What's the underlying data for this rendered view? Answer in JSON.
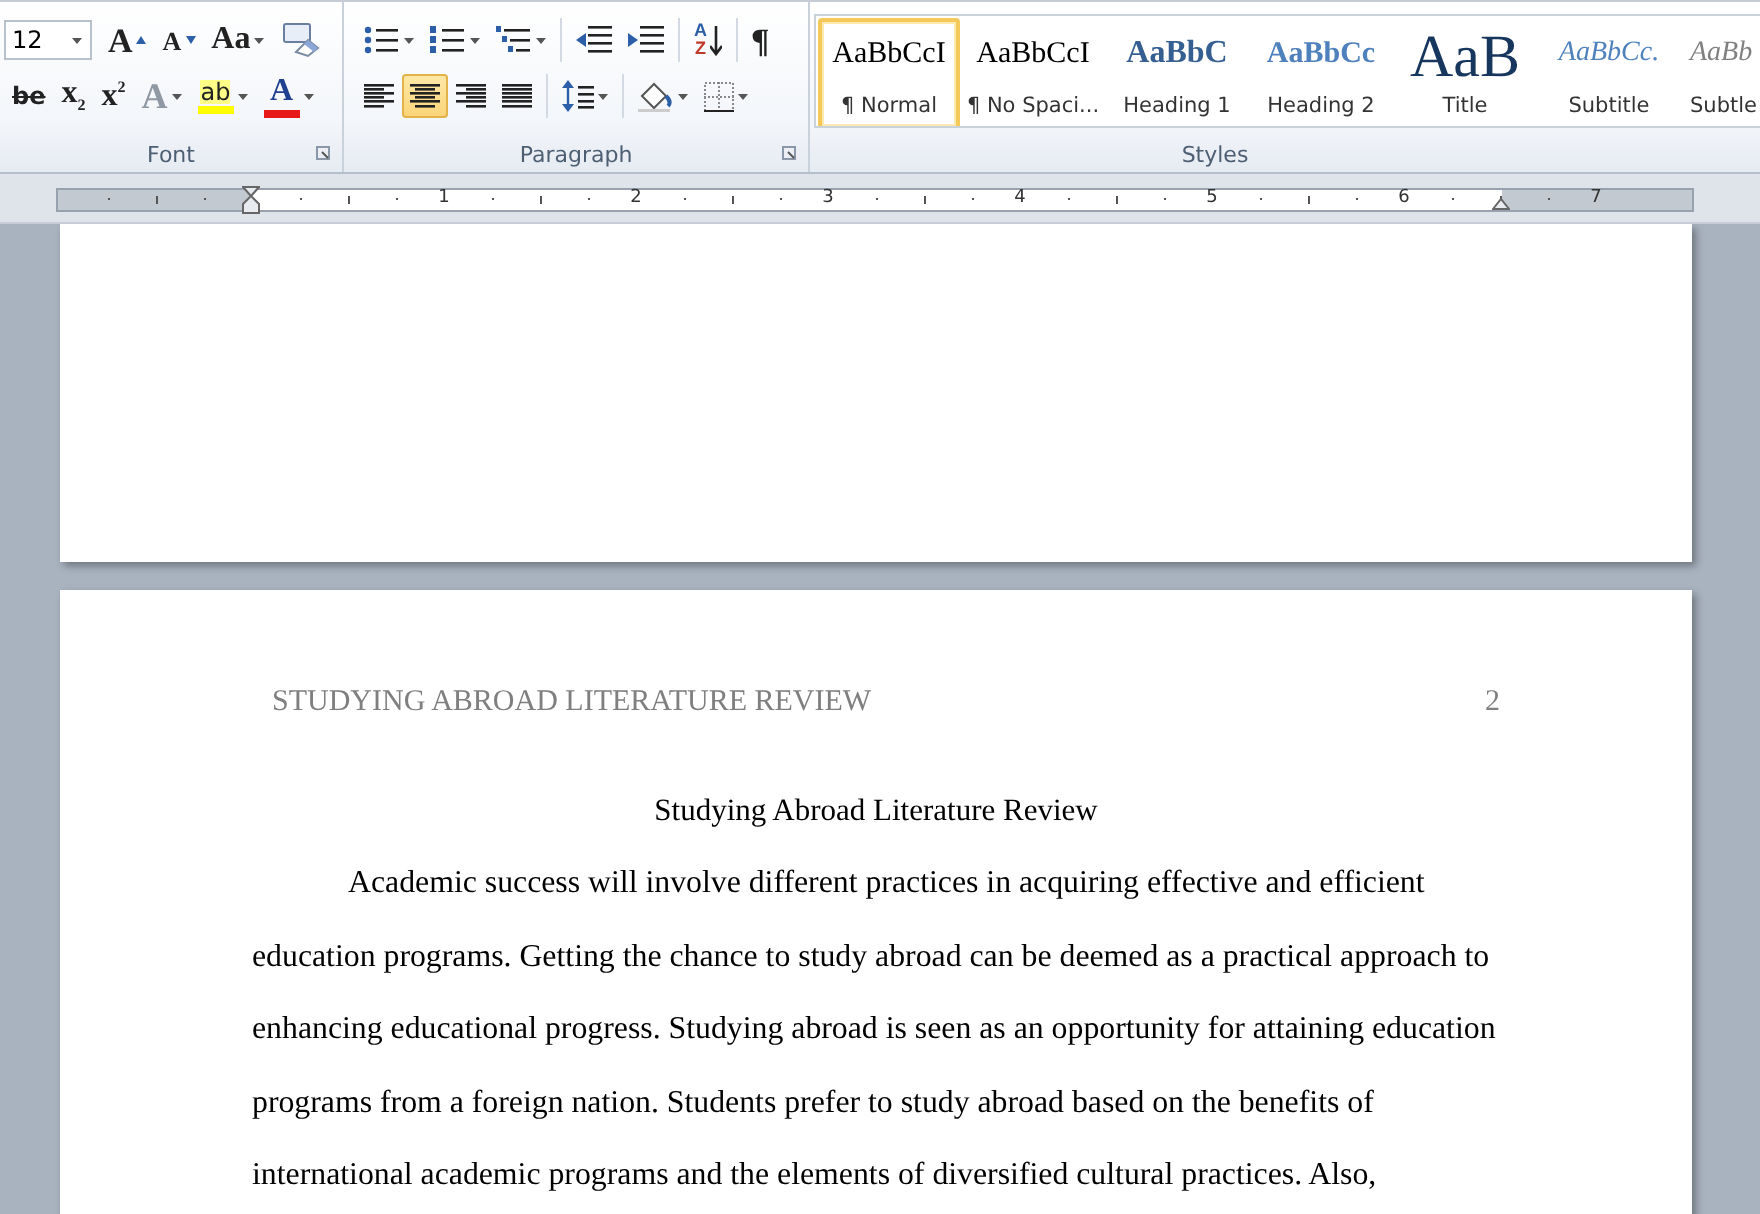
{
  "ribbon": {
    "font_group": {
      "label": "Font",
      "font_size": "12",
      "row_1": [
        {
          "kind": "grow_font",
          "text": "A",
          "dropdown": false,
          "disabled": false
        },
        {
          "kind": "shrink_font",
          "text": "A",
          "dropdown": false,
          "disabled": false
        },
        {
          "kind": "change_case",
          "text": "Aa",
          "dropdown": true,
          "disabled": false
        },
        {
          "kind": "clear_format",
          "dropdown": false
        }
      ],
      "row_2": [
        {
          "kind": "strikethrough",
          "text": "be",
          "dropdown": false,
          "disabled": false
        },
        {
          "kind": "subscript",
          "text": "x$_{2}$",
          "dropdown": false,
          "disabled": false
        },
        {
          "kind": "superscript",
          "text": "x$^{2}$",
          "dropdown": false,
          "disabled": false
        },
        {
          "kind": "text_effects",
          "text": "A",
          "dropdown": true,
          "disabled": true
        },
        {
          "kind": "highlight",
          "text": "ab",
          "color": "#ffff00",
          "dropdown": true,
          "disabled": false
        },
        {
          "kind": "font_color",
          "text": "A",
          "color": "#e81919",
          "dropdown": true,
          "disabled": false
        }
      ]
    },
    "paragraph_group": {
      "label": "Paragraph",
      "row_1": [
        {
          "kind": "bullets",
          "dropdown": true
        },
        {
          "kind": "numbering",
          "dropdown": true
        },
        {
          "kind": "multilevel",
          "dropdown": true
        },
        {
          "kind": "sep"
        },
        {
          "kind": "outdent",
          "dropdown": false
        },
        {
          "kind": "indent",
          "dropdown": false
        },
        {
          "kind": "sep"
        },
        {
          "kind": "sort",
          "text_top": "A",
          "text_bottom": "Z",
          "dropdown": false
        },
        {
          "kind": "sep"
        },
        {
          "kind": "show_marks",
          "text": "¶",
          "dropdown": false,
          "disabled": false
        }
      ],
      "row_2": [
        {
          "kind": "align_left",
          "dropdown": false,
          "selected": false
        },
        {
          "kind": "align_center",
          "dropdown": false,
          "selected": true
        },
        {
          "kind": "align_right",
          "dropdown": false,
          "selected": false
        },
        {
          "kind": "justify",
          "dropdown": false,
          "selected": false
        },
        {
          "kind": "sep"
        },
        {
          "kind": "line_spacing",
          "dropdown": true
        },
        {
          "kind": "sep"
        },
        {
          "kind": "shading",
          "dropdown": true
        },
        {
          "kind": "borders",
          "dropdown": true
        }
      ]
    },
    "styles_group": {
      "label": "Styles",
      "items": [
        {
          "kind": "normal",
          "preview": "AaBbCcI",
          "name": "¶ Normal",
          "selected": true
        },
        {
          "kind": "no_spacing",
          "preview": "AaBbCcI",
          "name": "¶ No Spaci...",
          "selected": false
        },
        {
          "kind": "heading_1",
          "preview": "AaBbC",
          "name": "Heading 1",
          "selected": false
        },
        {
          "kind": "heading_2",
          "preview": "AaBbCc",
          "name": "Heading 2",
          "selected": false
        },
        {
          "kind": "title",
          "preview": "AaB",
          "name": "Title",
          "selected": false
        },
        {
          "kind": "subtitle",
          "preview": "AaBbCc.",
          "name": "Subtitle",
          "selected": false
        },
        {
          "kind": "subtle",
          "preview": "AaBb",
          "name": "Subtle",
          "selected": false
        }
      ]
    }
  },
  "ruler": {
    "numbers": [
      "1",
      "2",
      "3",
      "4",
      "5",
      "6",
      "7"
    ]
  },
  "document": {
    "page_2": {
      "header": "STUDYING ABROAD LITERATURE REVIEW",
      "page_number": "2",
      "title": "Studying Abroad Literature Review",
      "paragraph": "Academic success will involve different practices in acquiring  effective and efficient education programs.  Getting the chance to study abroad can be deemed as a practical approach to enhancing  educational progress. Studying abroad is seen as an opportunity for attaining education programs  from a foreign nation. Students prefer to study abroad based on the benefits of international academic programs and the elements of diversified cultural practices.  Also,"
    }
  }
}
